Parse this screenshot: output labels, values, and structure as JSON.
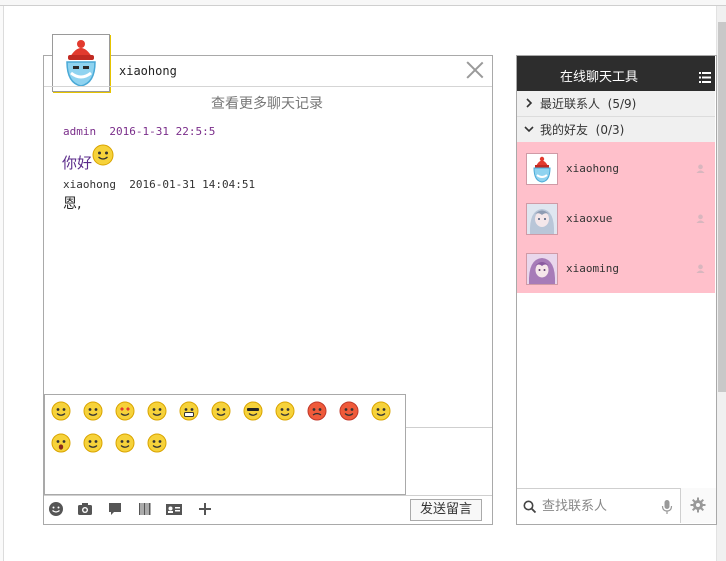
{
  "chat": {
    "contact_name": "xiaohong",
    "history_link": "查看更多聊天记录",
    "messages": [
      {
        "sender": "admin",
        "time": "2016-1-31 22:5:5",
        "text": "你好",
        "emoji": "smile-emoji"
      },
      {
        "sender": "xiaohong",
        "time": "2016-01-31 14:04:51",
        "text": "恩,"
      }
    ],
    "emoji_icons": [
      "smile",
      "shy-smile",
      "love-eyes",
      "surprised-blush",
      "grin",
      "blush",
      "cool-sunglasses",
      "smirk",
      "angry",
      "pout",
      "happy-blush",
      "shocked",
      "laugh-squint",
      "wink-kiss",
      "content-smile"
    ],
    "toolbar": {
      "icons": [
        "emoji-icon",
        "camera-icon",
        "chat-bubble-icon",
        "barcode-icon",
        "contact-card-icon",
        "plus-icon"
      ],
      "send_label": "发送留言"
    }
  },
  "contacts": {
    "title": "在线聊天工具",
    "groups": [
      {
        "label": "最近联系人",
        "count": "(5/9)",
        "expanded": false
      },
      {
        "label": "我的好友",
        "count": "(0/3)",
        "expanded": true
      }
    ],
    "friends": [
      {
        "name": "xiaohong",
        "avatar": "bearded-avatar-icon"
      },
      {
        "name": "xiaoxue",
        "avatar": "anime-girl-avatar-icon"
      },
      {
        "name": "xiaoming",
        "avatar": "purple-hair-avatar-icon"
      }
    ],
    "search_placeholder": "查找联系人"
  },
  "colors": {
    "header_dark": "#2d2d2d",
    "friend_highlight": "#ffc0cb",
    "admin_meta": "#7a2d8a"
  }
}
